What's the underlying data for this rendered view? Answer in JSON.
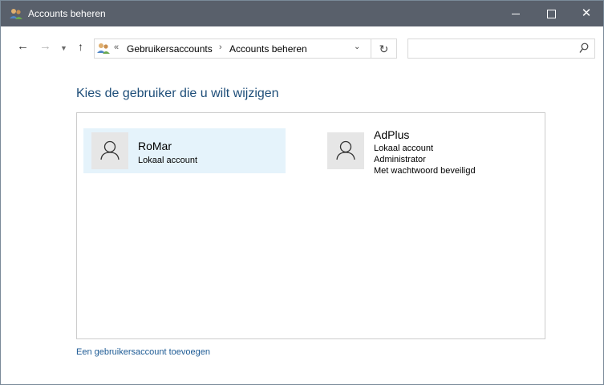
{
  "window": {
    "title": "Accounts beheren"
  },
  "navigation": {
    "breadcrumbs": [
      "Gebruikersaccounts",
      "Accounts beheren"
    ],
    "search_placeholder": ""
  },
  "content": {
    "heading": "Kies de gebruiker die u wilt wijzigen",
    "users": [
      {
        "name": "RoMar",
        "details": [
          "Lokaal account"
        ],
        "selected": true
      },
      {
        "name": "AdPlus",
        "details": [
          "Lokaal account",
          "Administrator",
          "Met wachtwoord beveiligd"
        ],
        "selected": false
      }
    ],
    "add_account_link": "Een gebruikersaccount toevoegen"
  },
  "colors": {
    "titlebar": "#59606b",
    "heading": "#1e4e79",
    "link": "#1c5a94",
    "selected_tile": "#e5f3fb"
  },
  "icons": [
    "users-icon",
    "minimize-icon",
    "maximize-icon",
    "close-icon",
    "back-arrow-icon",
    "forward-arrow-icon",
    "recent-locations-chevron-icon",
    "up-arrow-icon",
    "refresh-icon",
    "search-icon",
    "chevron-down-icon",
    "user-avatar-icon"
  ]
}
